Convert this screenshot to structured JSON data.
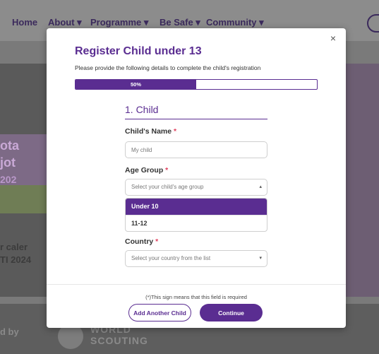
{
  "nav": {
    "items": [
      {
        "label": "Home"
      },
      {
        "label": "About ▾"
      },
      {
        "label": "Programme ▾"
      },
      {
        "label": "Be Safe ▾"
      },
      {
        "label": "Community ▾"
      }
    ]
  },
  "background": {
    "left_text_1": "ota",
    "left_text_2": "jot",
    "left_text_3": "202",
    "left_text_4": "r caler",
    "left_text_5": "TI 2024",
    "footer_left": "d by",
    "logo_line1": "WORLD",
    "logo_line2": "SCOUTING"
  },
  "modal": {
    "close_symbol": "×",
    "title": "Register Child under 13",
    "subtitle": "Please provide the following details to complete the child's registration",
    "progress": {
      "value": 50,
      "label": "50%"
    },
    "section_title": "1. Child",
    "fields": {
      "name": {
        "label": "Child's Name",
        "required_mark": "*",
        "placeholder": "My child"
      },
      "age_group": {
        "label": "Age Group",
        "required_mark": "*",
        "placeholder": "Select your child's age group",
        "caret": "▴",
        "options": [
          {
            "label": "Under 10",
            "selected": true
          },
          {
            "label": "11-12",
            "selected": false
          }
        ]
      },
      "country": {
        "label": "Country",
        "required_mark": "*",
        "placeholder": "Select your country from the list",
        "caret": "▾"
      }
    },
    "required_note": "(*)This sign means that this field is required",
    "buttons": {
      "add_another": "Add Another Child",
      "continue": "Continue"
    }
  },
  "colors": {
    "brand_purple": "#5a2d91",
    "required_red": "#e0405e"
  }
}
